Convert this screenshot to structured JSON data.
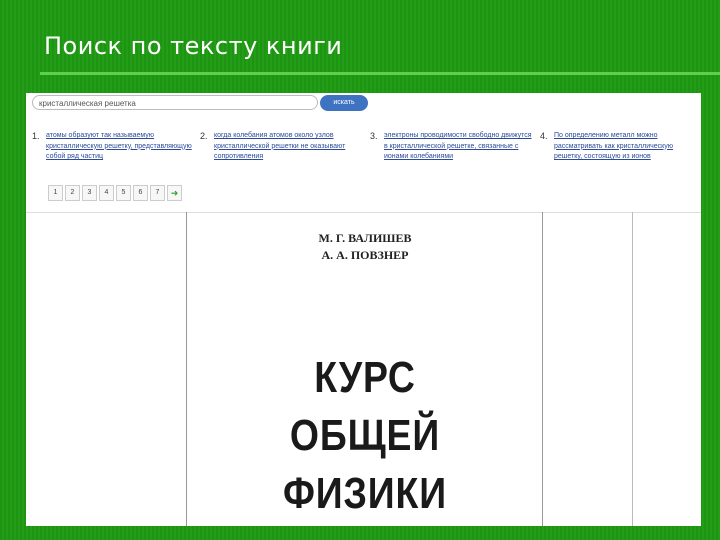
{
  "slide": {
    "title": "Поиск по тексту книги"
  },
  "search": {
    "query": "кристаллическая решетка",
    "button_label": "искать"
  },
  "results": [
    {
      "num": "1.",
      "text": "атомы образуют так называемую кристаллическую решетку, представляющую собой ряд частиц"
    },
    {
      "num": "2.",
      "text": "когда колебания атомов около узлов кристаллической решетки не оказывают сопротивления"
    },
    {
      "num": "3.",
      "text": "электроны проводимости свободно движутся в кристаллической решетке, связанные с ионами колебаниями"
    },
    {
      "num": "4.",
      "text": "По определению металл можно рассматривать как кристаллическую решетку, состоящую из ионов"
    }
  ],
  "pager": {
    "pages": [
      "1",
      "2",
      "3",
      "4",
      "5",
      "6",
      "7"
    ],
    "next": "➜"
  },
  "book": {
    "author1": "М. Г. ВАЛИШЕВ",
    "author2": "А. А. ПОВЗНЕР",
    "title_line1": "КУРС",
    "title_line2": "ОБЩЕЙ",
    "title_line3": "ФИЗИКИ"
  },
  "colors": {
    "background": "#1f9a12",
    "accent": "#5ed04a",
    "button": "#3f72c0",
    "link": "#2a4a9a"
  }
}
